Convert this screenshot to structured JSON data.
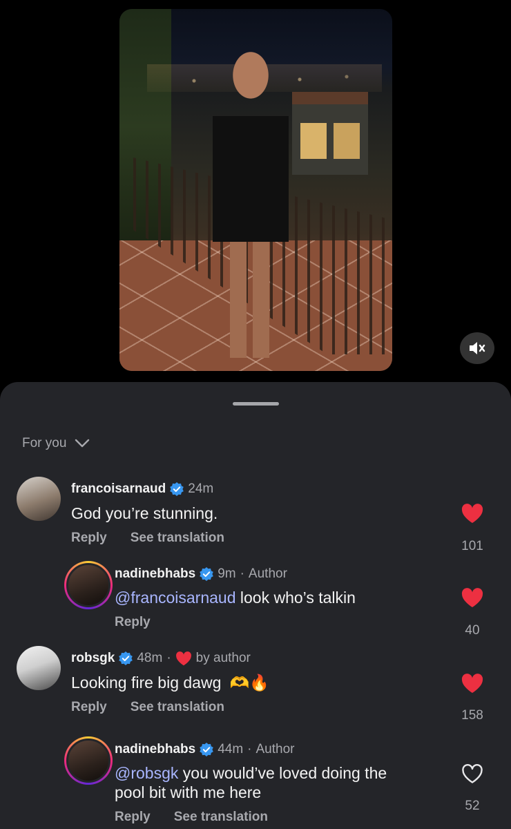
{
  "media": {
    "mute_icon": "speaker-muted-icon"
  },
  "sheet": {
    "filter_label": "For you",
    "filter_icon": "chevron-down-icon"
  },
  "comments": [
    {
      "username": "francoisarnaud",
      "verified": true,
      "time": "24m",
      "text": "God you’re stunning.",
      "reply_label": "Reply",
      "translate_label": "See translation",
      "likes": "101",
      "liked": true
    },
    {
      "username": "nadinebhabs",
      "verified": true,
      "time": "9m",
      "separator": "·",
      "badge": "Author",
      "mention": "@francoisarnaud",
      "text": " look who’s talkin",
      "reply_label": "Reply",
      "likes": "40",
      "liked": true
    },
    {
      "username": "robsgk",
      "verified": true,
      "time": "48m",
      "separator": "·",
      "liked_by": "by author",
      "text": "Looking fire big dawg",
      "emojis": "🫶🔥",
      "reply_label": "Reply",
      "translate_label": "See translation",
      "likes": "158",
      "liked": true
    },
    {
      "username": "nadinebhabs",
      "verified": true,
      "time": "44m",
      "separator": "·",
      "badge": "Author",
      "mention": "@robsgk",
      "text_line1": " you would’ve loved doing the",
      "text_line2": "pool bit with me here",
      "reply_label": "Reply",
      "translate_label": "See translation",
      "likes": "52",
      "liked": false
    }
  ],
  "colors": {
    "background": "#000000",
    "sheet": "#242529",
    "like_red": "#ed3041",
    "verified_blue": "#3897f0",
    "mention": "#a9b6ff",
    "secondary_text": "#a8a9ae"
  }
}
